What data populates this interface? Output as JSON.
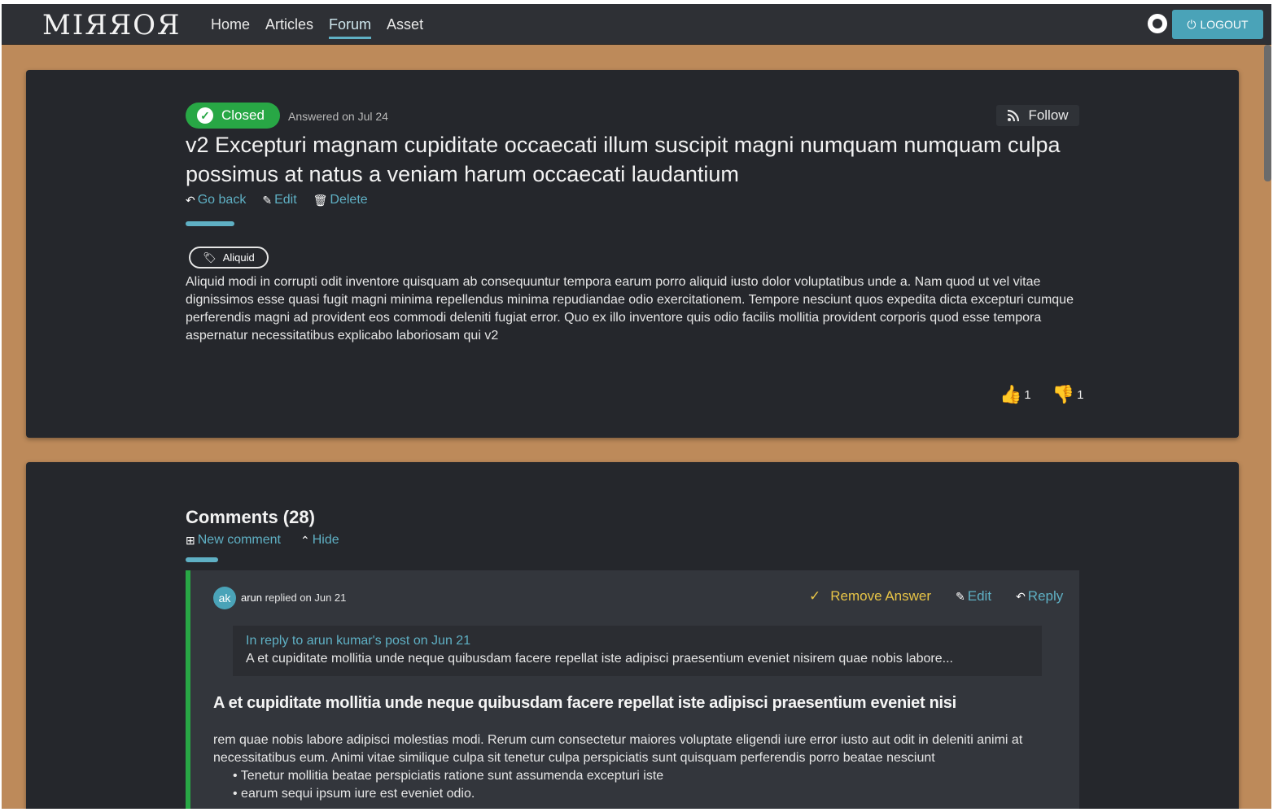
{
  "navbar": {
    "logo": "MIЯЯOЯ",
    "links": [
      "Home",
      "Articles",
      "Forum",
      "Asset"
    ],
    "active_link": "Forum",
    "logout_label": "LOGOUT"
  },
  "question": {
    "status": "Closed",
    "answered": "Answered on Jul 24",
    "follow_label": "Follow",
    "title": "v2 Excepturi magnam cupiditate occaecati illum suscipit magni numquam numquam culpa possimus at natus a veniam harum occaecati laudantium",
    "actions": {
      "go_back": "Go back",
      "edit": "Edit",
      "delete": "Delete"
    },
    "tag": "Aliquid",
    "body": "Aliquid modi in corrupti odit inventore quisquam ab consequuntur tempora earum porro aliquid iusto dolor voluptatibus unde a. Nam quod ut vel vitae dignissimos esse quasi fugit magni minima repellendus minima repudiandae odio exercitationem. Tempore nesciunt quos expedita dicta excepturi cumque perferendis magni ad provident eos commodi deleniti fugiat error. Quo ex illo inventore quis odio facilis mollitia provident corporis quod esse tempora aspernatur necessitatibus explicabo laboriosam qui v2",
    "upvotes": "1",
    "downvotes": "1"
  },
  "comments": {
    "title": "Comments (28)",
    "new_comment": "New comment",
    "hide": "Hide",
    "items": [
      {
        "avatar": "ak",
        "author": "arun",
        "replied": "replied on Jun 21",
        "remove_answer": "Remove Answer",
        "edit": "Edit",
        "reply": "Reply",
        "quote_link": "In reply to arun kumar's post on Jun 21",
        "quote_text": "A et cupiditate mollitia unde neque quibusdam facere repellat iste adipisci praesentium eveniet nisirem quae nobis labore...",
        "heading": "A et cupiditate mollitia unde neque quibusdam facere repellat iste adipisci praesentium eveniet nisi",
        "body": "rem quae nobis labore adipisci molestias modi. Rerum cum consectetur maiores voluptate eligendi iure error iusto aut odit in deleniti animi at necessitatibus eum. Animi vitae similique culpa sit tenetur culpa perspiciatis sunt quisquam perferendis porro beatae nesciunt",
        "bullets": [
          "Tenetur mollitia beatae perspiciatis ratione sunt assumenda excepturi iste",
          "earum sequi ipsum iure est eveniet odio."
        ]
      }
    ]
  },
  "colors": {
    "accent": "#5fb0c4",
    "success": "#28a745",
    "danger": "#d9534f",
    "background": "#bd8a5a",
    "card": "#25272c"
  }
}
